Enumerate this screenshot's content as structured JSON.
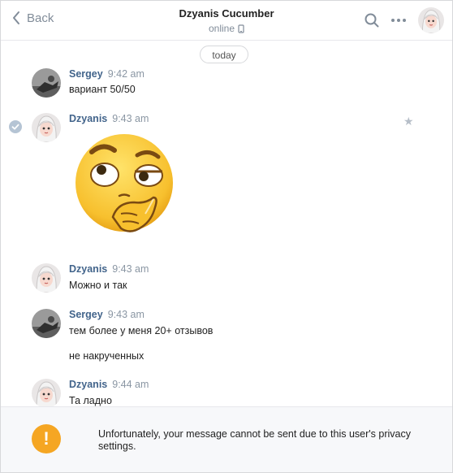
{
  "header": {
    "back_label": "Back",
    "title": "Dzyanis Cucumber",
    "status": "online"
  },
  "date_divider": "today",
  "messages": [
    {
      "name": "Sergey",
      "time": "9:42 am",
      "lines": [
        "вариант 50/50"
      ]
    },
    {
      "name": "Dzyanis",
      "time": "9:43 am",
      "lines": []
    },
    {
      "name": "Dzyanis",
      "time": "9:43 am",
      "lines": [
        "Можно и так"
      ]
    },
    {
      "name": "Sergey",
      "time": "9:43 am",
      "lines": [
        "тем более у меня 20+ отзывов",
        "не накрученных"
      ]
    },
    {
      "name": "Dzyanis",
      "time": "9:44 am",
      "lines": [
        "Та ладно"
      ]
    }
  ],
  "notice": {
    "text": "Unfortunately, your message cannot be sent due to this user's privacy settings."
  },
  "colors": {
    "name": "#42648b",
    "time": "#8a96a3",
    "warning": "#f5a623",
    "sticker_yellow": "#f7c02e"
  }
}
